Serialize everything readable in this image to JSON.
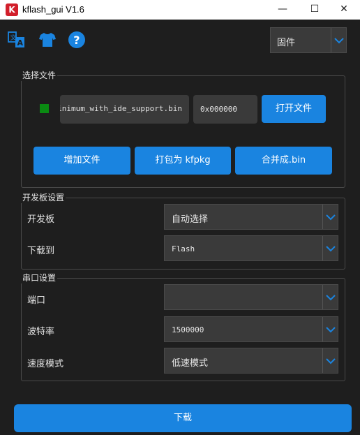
{
  "window": {
    "title": "kflash_gui V1.6",
    "app_icon_letter": "K",
    "minimize": "—",
    "maximize": "☐",
    "close": "✕"
  },
  "toolbar": {
    "icons": [
      "translate-icon",
      "shirt-icon",
      "help-icon"
    ],
    "firmware_select": "固件"
  },
  "file_group": {
    "title": "选择文件",
    "file_path": "inimum_with_ide_support.bin",
    "address": "0x000000",
    "open_button": "打开文件",
    "add_button": "增加文件",
    "pack_button": "打包为 kfpkg",
    "merge_button": "合并成.bin"
  },
  "board_group": {
    "title": "开发板设置",
    "board_label": "开发板",
    "board_value": "自动选择",
    "download_to_label": "下载到",
    "download_to_value": "Flash"
  },
  "serial_group": {
    "title": "串口设置",
    "port_label": "端口",
    "port_value": "",
    "baud_label": "波特率",
    "baud_value": "1500000",
    "speed_label": "速度模式",
    "speed_value": "低速模式"
  },
  "download_button": "下载",
  "colors": {
    "accent": "#1a84e0",
    "status_ok": "#0a8a12",
    "background": "#1e1e1e",
    "field": "#3a3a3a",
    "close_red": "#d21f2b"
  }
}
